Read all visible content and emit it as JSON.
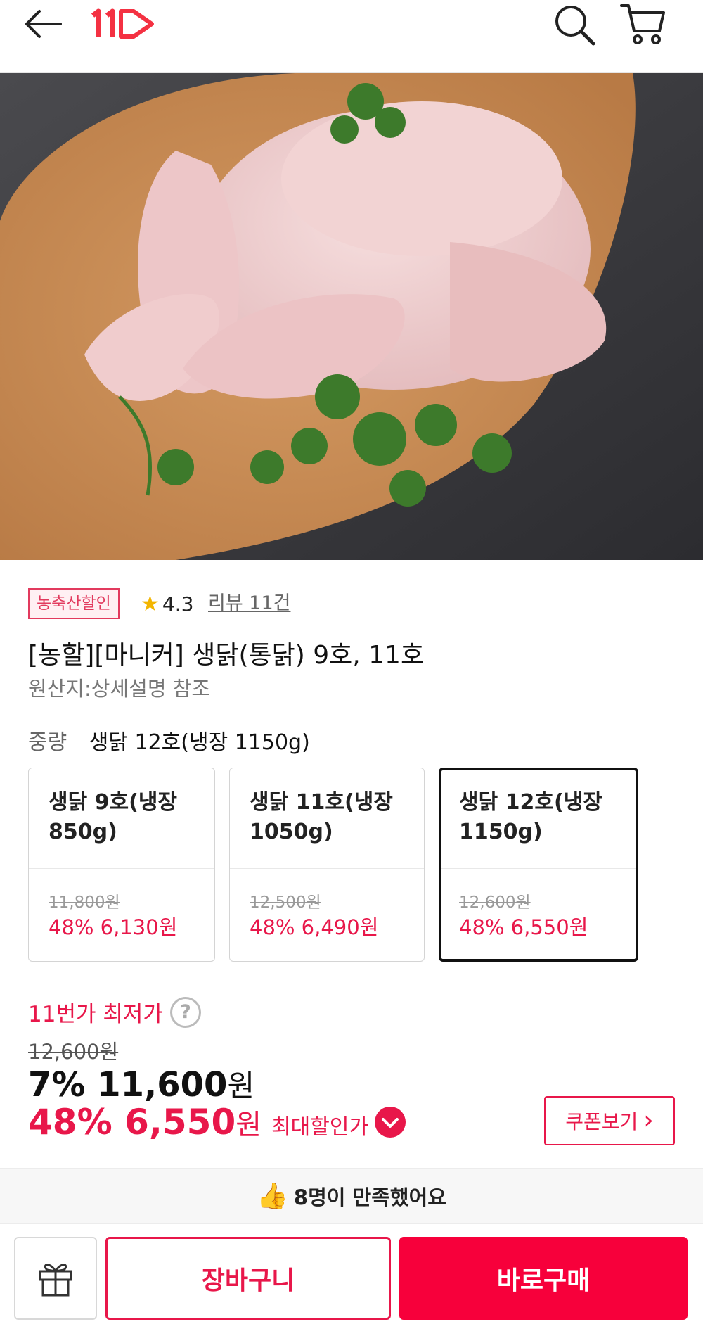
{
  "header": {
    "logo_text": "11",
    "brand_color": "#f43142"
  },
  "hero": {
    "image_alt": "생닭(통닭)",
    "slide_count": 4,
    "active_slide": 1
  },
  "meta": {
    "badge": "농축산할인",
    "rating": "4.3",
    "review_link": "리뷰 11건"
  },
  "product": {
    "title": "[농할][마니커] 생닭(통닭) 9호, 11호",
    "origin": "원산지:상세설명 참조",
    "weight_label": "중량",
    "weight_value": "생닭 12호(냉장 1150g)"
  },
  "options": [
    {
      "name": "생닭 9호(냉장 850g)",
      "original_price": "11,800원",
      "sale_price": "48% 6,130원",
      "selected": false
    },
    {
      "name": "생닭 11호(냉장 1050g)",
      "original_price": "12,500원",
      "sale_price": "48% 6,490원",
      "selected": false
    },
    {
      "name": "생닭 12호(냉장 1150g)",
      "original_price": "12,600원",
      "sale_price": "48% 6,550원",
      "selected": true
    }
  ],
  "price": {
    "lowest_label": "11번가 최저가",
    "help_glyph": "?",
    "strike_price": "12,600원",
    "discount_pct": "7%",
    "discount_amount": "11,600",
    "won": "원",
    "max_pct": "48%",
    "max_amount": "6,550",
    "max_label": "최대할인가"
  },
  "coupon": {
    "label": "쿠폰보기",
    "chevron": "›"
  },
  "satisfaction": {
    "thumb": "👍",
    "text": "8명이 만족했어요"
  },
  "bottom_bar": {
    "cart_label": "장바구니",
    "buy_label": "바로구매"
  },
  "colors": {
    "accent": "#e8174a",
    "buy_button": "#f7003b",
    "star": "#f3b500"
  }
}
